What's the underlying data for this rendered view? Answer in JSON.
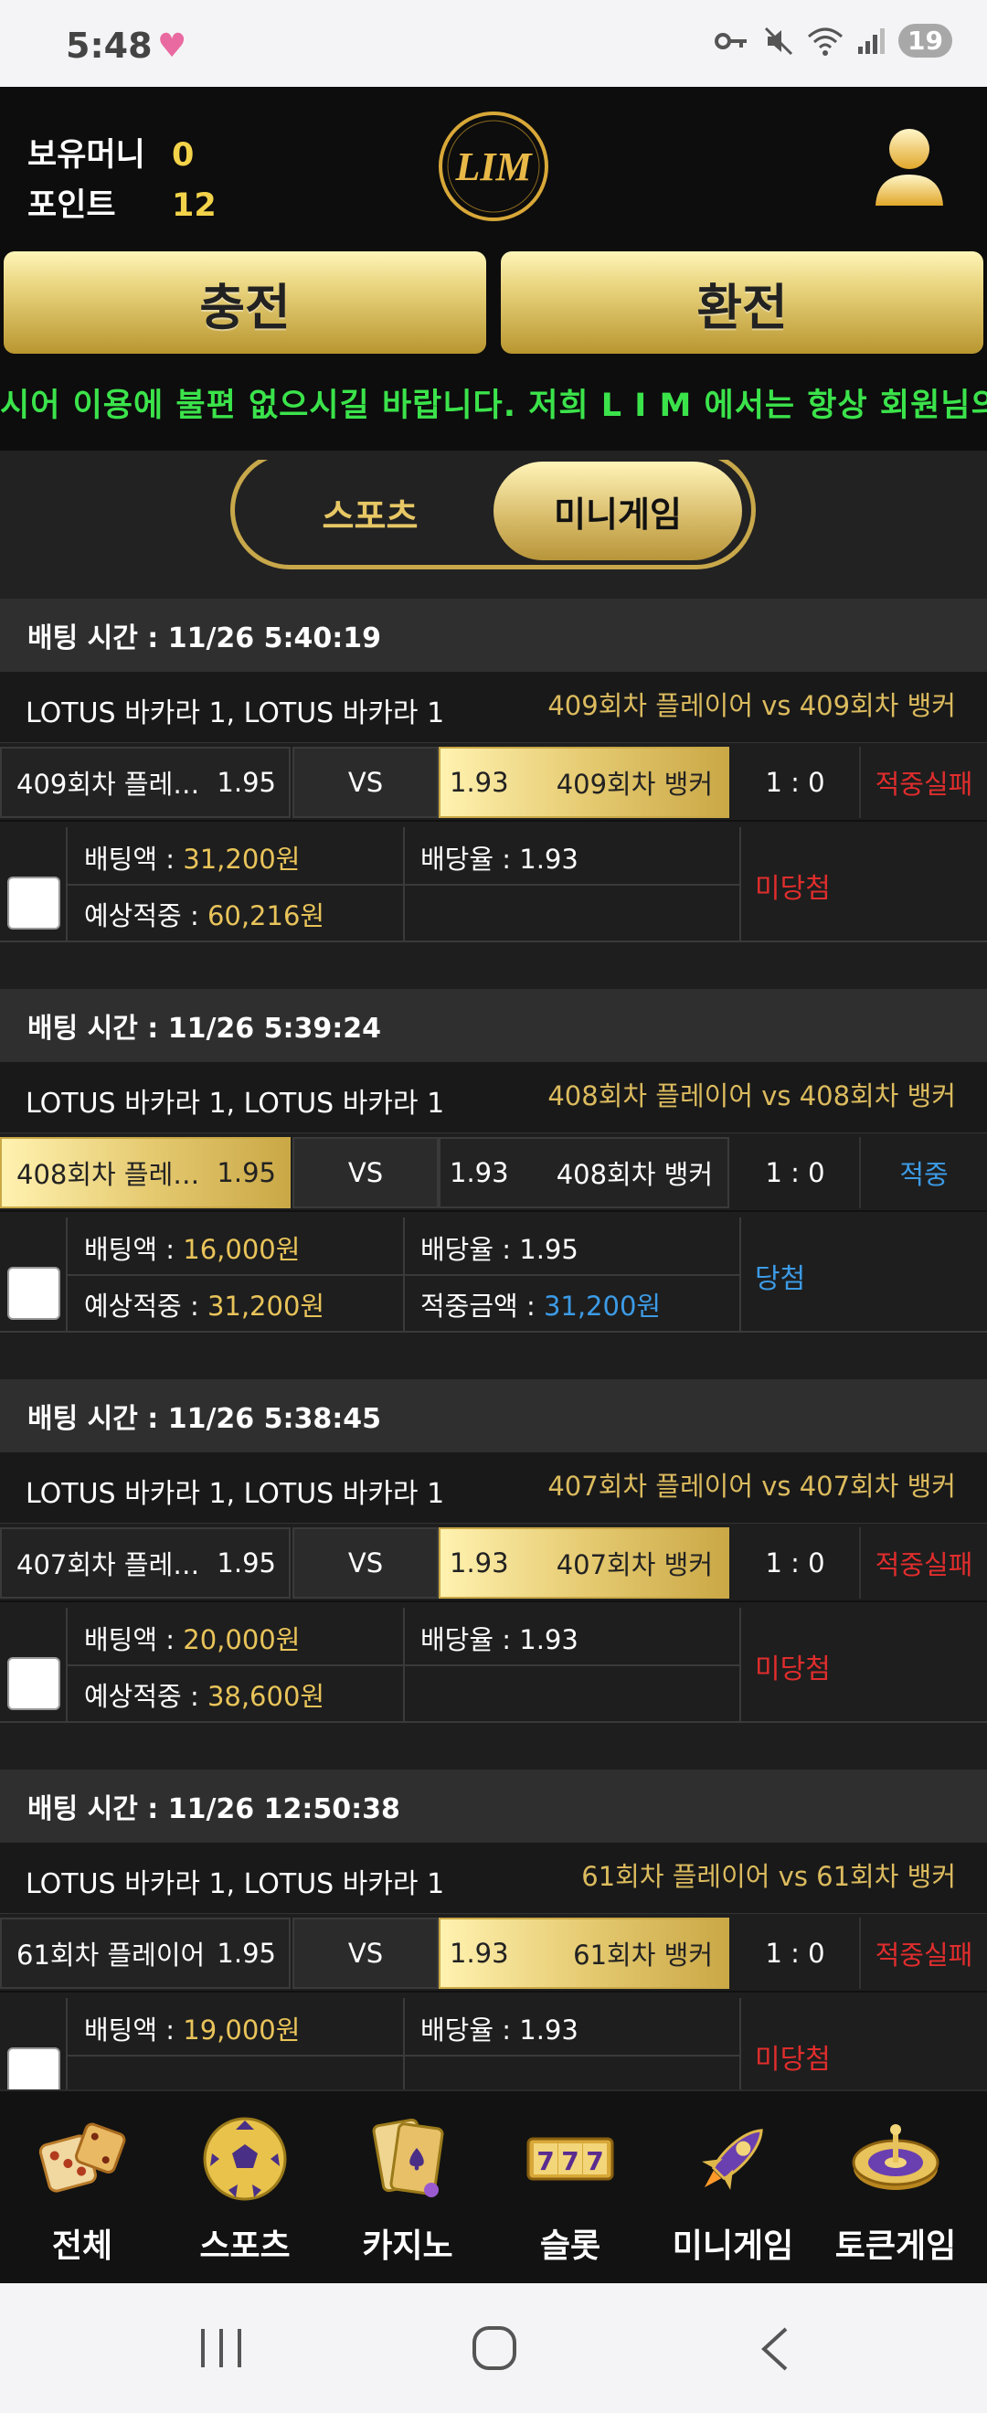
{
  "status_bar": {
    "time": "5:48",
    "notifications": "19"
  },
  "header": {
    "wallet_label": "보유머니",
    "wallet_value": "0",
    "point_label": "포인트",
    "point_value": "12",
    "logo_text": "LIM"
  },
  "actions": {
    "charge": "충전",
    "exchange": "환전"
  },
  "ticker": "시어 이용에 불편 없으시길 바랍니다. 저희 L I M 에서는 항상 회원님의 대승",
  "tabs": {
    "sports": "스포츠",
    "minigame": "미니게임"
  },
  "labels": {
    "bet_amount": "배팅액 : ",
    "expected": "예상적중 : ",
    "odds": "배당율 : ",
    "win_amount": "적중금액 : ",
    "vs": "VS"
  },
  "bets": [
    {
      "time": "배팅 시간 : 11/26 5:40:19",
      "game": "LOTUS 바카라 1, LOTUS 바카라 1",
      "match": "409회차 플레이어  vs  409회차 뱅커",
      "left_name": "409회차 플레…",
      "left_odds": "1.95",
      "right_odds": "1.93",
      "right_name": "409회차 뱅커",
      "score": "1 : 0",
      "result": "적중실패",
      "amount": "31,200원",
      "expected": "60,216원",
      "odds": "1.93",
      "win_amount": "",
      "state": "미당첨"
    },
    {
      "time": "배팅 시간 : 11/26 5:39:24",
      "game": "LOTUS 바카라 1, LOTUS 바카라 1",
      "match": "408회차 플레이어  vs  408회차 뱅커",
      "left_name": "408회차 플레…",
      "left_odds": "1.95",
      "right_odds": "1.93",
      "right_name": "408회차 뱅커",
      "score": "1 : 0",
      "result": "적중",
      "amount": "16,000원",
      "expected": "31,200원",
      "odds": "1.95",
      "win_amount": "31,200원",
      "state": "당첨"
    },
    {
      "time": "배팅 시간 : 11/26 5:38:45",
      "game": "LOTUS 바카라 1, LOTUS 바카라 1",
      "match": "407회차 플레이어  vs  407회차 뱅커",
      "left_name": "407회차 플레…",
      "left_odds": "1.95",
      "right_odds": "1.93",
      "right_name": "407회차 뱅커",
      "score": "1 : 0",
      "result": "적중실패",
      "amount": "20,000원",
      "expected": "38,600원",
      "odds": "1.93",
      "win_amount": "",
      "state": "미당첨"
    },
    {
      "time": "배팅 시간 : 11/26 12:50:38",
      "game": "LOTUS 바카라 1, LOTUS 바카라 1",
      "match": "61회차 플레이어  vs  61회차 뱅커",
      "left_name": "61회차 플레이어",
      "left_odds": "1.95",
      "right_odds": "1.93",
      "right_name": "61회차 뱅커",
      "score": "1 : 0",
      "result": "적중실패",
      "amount": "19,000원",
      "expected": "",
      "odds": "1.93",
      "win_amount": "",
      "state": "미당첨"
    }
  ],
  "bottom_nav": [
    {
      "label": "전체",
      "icon": "dice-icon"
    },
    {
      "label": "스포츠",
      "icon": "soccer-ball-icon"
    },
    {
      "label": "카지노",
      "icon": "cards-icon"
    },
    {
      "label": "슬롯",
      "icon": "slot-777-icon"
    },
    {
      "label": "미니게임",
      "icon": "rocket-icon"
    },
    {
      "label": "토큰게임",
      "icon": "roulette-icon"
    }
  ]
}
